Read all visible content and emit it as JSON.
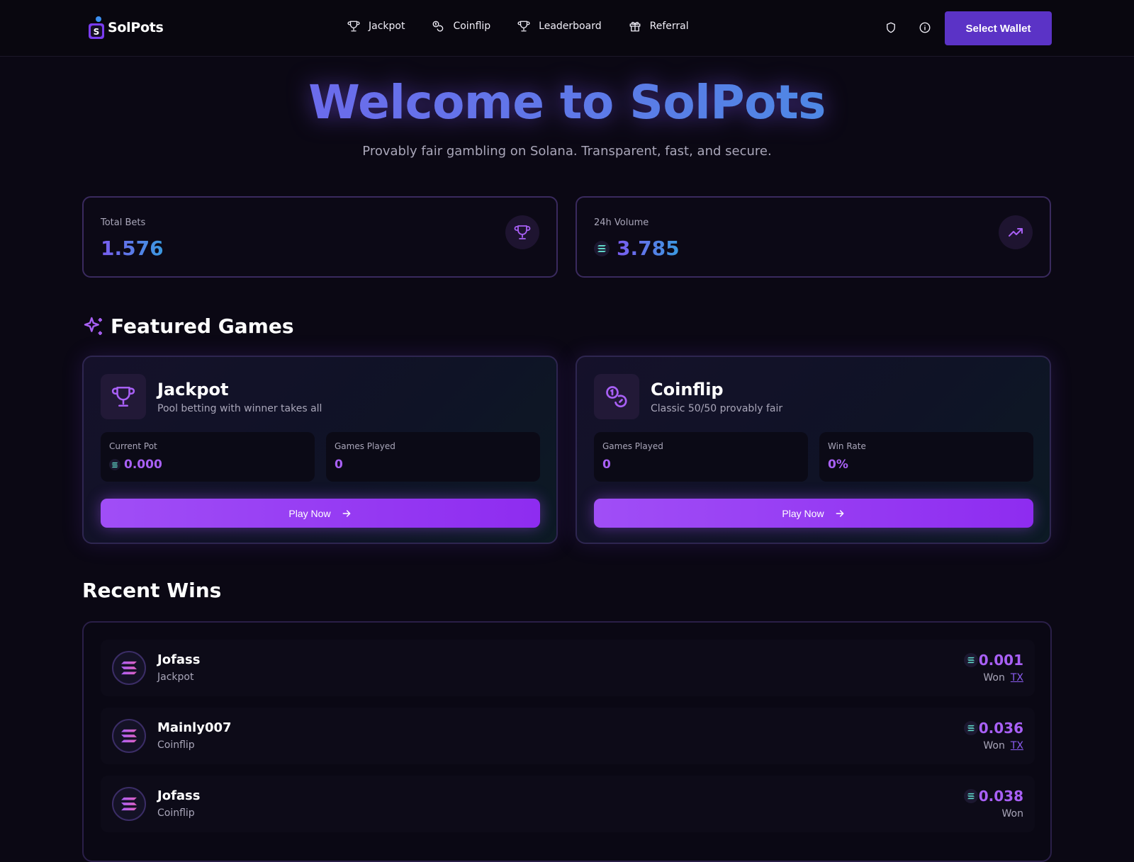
{
  "header": {
    "logo_text": "SolPots",
    "nav": [
      {
        "label": "Jackpot",
        "icon": "trophy-icon"
      },
      {
        "label": "Coinflip",
        "icon": "coins-icon"
      },
      {
        "label": "Leaderboard",
        "icon": "trophy-icon"
      },
      {
        "label": "Referral",
        "icon": "gift-icon"
      }
    ],
    "wallet_button": "Select Wallet"
  },
  "hero": {
    "title": "Welcome to SolPots",
    "subtitle": "Provably fair gambling on Solana. Transparent, fast, and secure."
  },
  "stats": [
    {
      "label": "Total Bets",
      "value": "1.576"
    },
    {
      "label": "24h Volume",
      "value": "3.785"
    }
  ],
  "featured": {
    "title": "Featured Games",
    "games": [
      {
        "title": "Jackpot",
        "description": "Pool betting with winner takes all",
        "stats": [
          {
            "label": "Current Pot",
            "value": "0.000"
          },
          {
            "label": "Games Played",
            "value": "0"
          }
        ],
        "button": "Play Now"
      },
      {
        "title": "Coinflip",
        "description": "Classic 50/50 provably fair",
        "stats": [
          {
            "label": "Games Played",
            "value": "0"
          },
          {
            "label": "Win Rate",
            "value": "0%"
          }
        ],
        "button": "Play Now"
      }
    ]
  },
  "recent_wins": {
    "title": "Recent Wins",
    "rows": [
      {
        "name": "Jofass",
        "game": "Jackpot",
        "amount": "0.001",
        "status": "Won",
        "tx": "TX"
      },
      {
        "name": "Mainly007",
        "game": "Coinflip",
        "amount": "0.036",
        "status": "Won",
        "tx": "TX"
      },
      {
        "name": "Jofass",
        "game": "Coinflip",
        "amount": "0.038",
        "status": "Won",
        "tx": ""
      }
    ]
  },
  "colors": {
    "accent": "#a04ef6",
    "wallet": "#5b33c6",
    "background": "#0b0814"
  }
}
